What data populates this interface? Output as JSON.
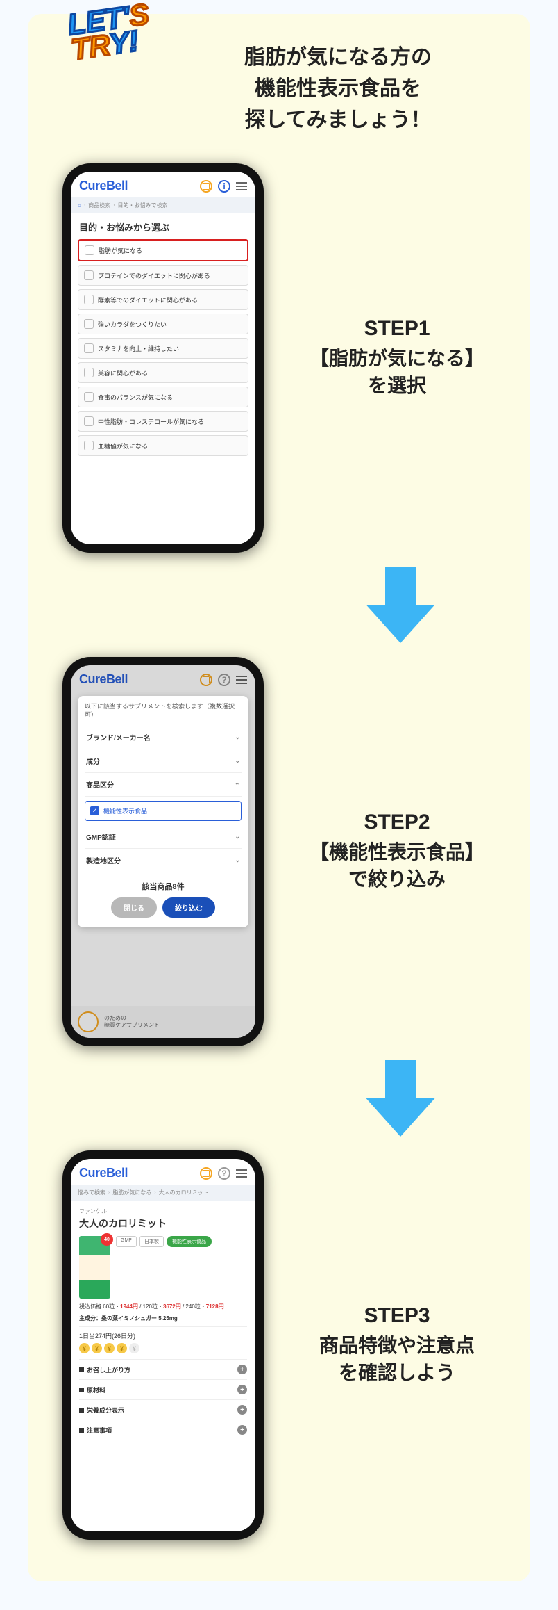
{
  "intro_lines": [
    "脂肪が気になる方の",
    "機能性表示食品を",
    "探してみましょう！"
  ],
  "app_name": "CureBell",
  "step1": {
    "title": "STEP1",
    "desc1": "【脂肪が気になる】",
    "desc2": "を選択",
    "breadcrumb": {
      "home": "⌂",
      "p1": "商品検索",
      "p2": "目的・お悩みで検索"
    },
    "section_title": "目的・お悩みから選ぶ",
    "options": [
      "脂肪が気になる",
      "プロテインでのダイエットに関心がある",
      "酵素等でのダイエットに関心がある",
      "強いカラダをつくりたい",
      "スタミナを向上・維持したい",
      "美容に関心がある",
      "食事のバランスが気になる",
      "中性脂肪・コレステロールが気になる",
      "血糖値が気になる"
    ]
  },
  "step2": {
    "title": "STEP2",
    "desc1": "【機能性表示食品】",
    "desc2": "で絞り込み",
    "sheet_title": "以下に該当するサプリメントを検索します（複数選択可）",
    "filters": [
      {
        "label": "ブランド/メーカー名",
        "open": false
      },
      {
        "label": "成分",
        "open": false
      },
      {
        "label": "商品区分",
        "open": true,
        "check": "機能性表示食品"
      },
      {
        "label": "GMP認証",
        "open": false
      },
      {
        "label": "製造地区分",
        "open": false
      }
    ],
    "count": "該当商品8件",
    "btn_close": "閉じる",
    "btn_apply": "絞り込む",
    "bg_text1": "のための",
    "bg_text2": "糖質ケアサプリメント"
  },
  "step3": {
    "title": "STEP3",
    "desc1": "商品特徴や注意点",
    "desc2": "を確認しよう",
    "breadcrumb": {
      "p1": "悩みで検索",
      "p2": "脂肪が気になる",
      "p3": "大人のカロリミット"
    },
    "brand": "ファンケル",
    "product_name": "大人のカロリミット",
    "badges": [
      "GMP",
      "日本製"
    ],
    "badge_green": "機能性表示食品",
    "price_label": "税込価格 60粒・",
    "price1": "1944円",
    "price_sep1": " / ",
    "price2_label": "120粒・",
    "price2": "3672円",
    "price_sep2": " / ",
    "price3_label": "240粒・",
    "price3": "7128円",
    "ingredient": "主成分：桑の葉イミノシュガー 5.25mg",
    "daily": "1日当274円(26日分)",
    "accordion": [
      "お召し上がり方",
      "原材料",
      "栄養成分表示",
      "注意事項"
    ]
  }
}
